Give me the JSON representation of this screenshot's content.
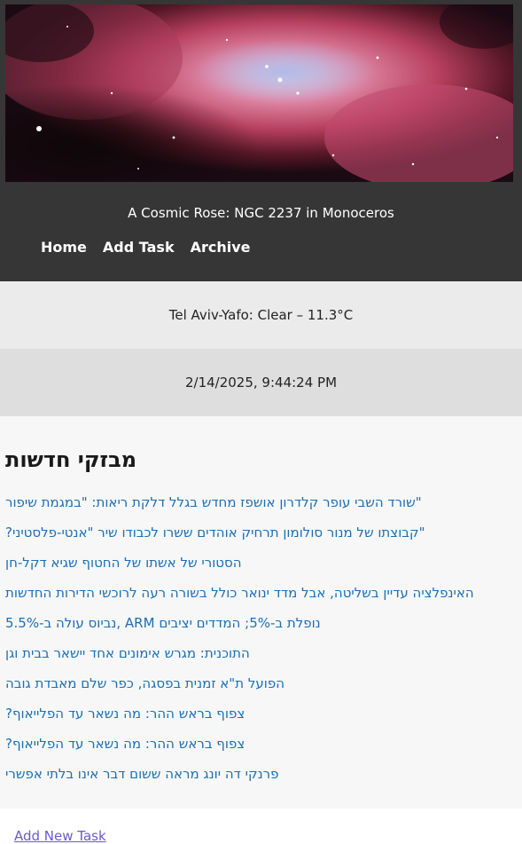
{
  "header": {
    "hero_caption": "A Cosmic Rose: NGC 2237 in Monoceros",
    "nav": {
      "home": "Home",
      "add_task": "Add Task",
      "archive": "Archive"
    }
  },
  "weather": {
    "text": "Tel Aviv-Yafo: Clear – 11.3°C"
  },
  "clock": {
    "text": "2/14/2025, 9:44:24 PM"
  },
  "news": {
    "title": "מבזקי חדשות",
    "items": [
      "\"שורד השבי עופר קלדרון אושפז מחדש בגלל דלקת ריאות: \"במגמת שיפור",
      "\"קבוצתו של מנור סולומון תרחיק אוהדים ששרו לכבודו שיר \"אנטי-פלסטיני?",
      "הסטורי של אשתו של החטוף שגיא דקל-חן",
      "האינפלציה עדיין בשליטה, אבל מדד ינואר כולל בשורה רעה לרוכשי הדירות החדשות",
      "נופלת ב-5%; המדדים יציבים ARM ,נביוס עולה ב-5.5%",
      "התוכנית: מגרש אימונים אחד יישאר בבית וגן",
      "הפועל ת\"א זמנית בפסגה, כפר שלם מאבדת גובה",
      "צפוף בראש ההר: מה נשאר עד הפלייאוף?",
      "צפוף בראש ההר: מה נשאר עד הפלייאוף?",
      "פרנקי דה יונג מראה ששום דבר אינו בלתי אפשרי"
    ]
  },
  "footer": {
    "add_new_task": "Add New Task"
  },
  "colors": {
    "header_bg": "#363636",
    "weather_bg": "#ebebeb",
    "clock_bg": "#dedede",
    "news_bg": "#f7f7f7",
    "link": "#1a6fb5",
    "footer_link": "#6a5acd"
  }
}
